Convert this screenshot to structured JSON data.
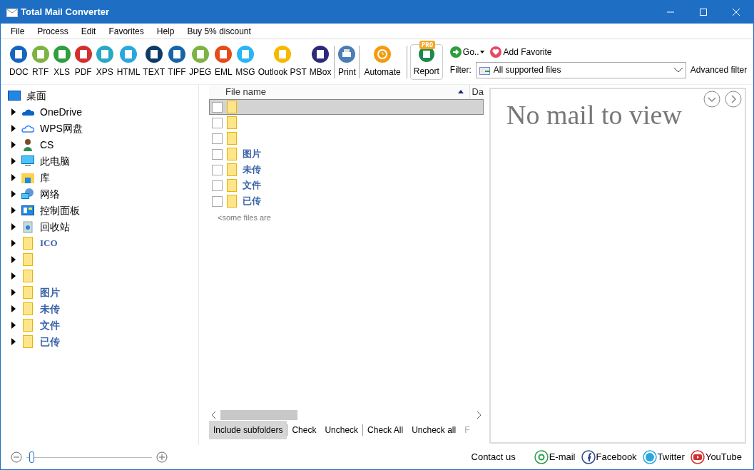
{
  "window": {
    "title": "Total Mail Converter"
  },
  "menu": [
    "File",
    "Process",
    "Edit",
    "Favorites",
    "Help",
    "Buy 5% discount"
  ],
  "toolbar": [
    {
      "label": "DOC",
      "color": "#1565c0"
    },
    {
      "label": "RTF",
      "color": "#7cb342"
    },
    {
      "label": "XLS",
      "color": "#2e9e3e"
    },
    {
      "label": "PDF",
      "color": "#d32f2f"
    },
    {
      "label": "XPS",
      "color": "#26a9c4"
    },
    {
      "label": "HTML",
      "color": "#29a8e0"
    },
    {
      "label": "TEXT",
      "color": "#0d3b66"
    },
    {
      "label": "TIFF",
      "color": "#1565a8"
    },
    {
      "label": "JPEG",
      "color": "#7cb342"
    },
    {
      "label": "EML",
      "color": "#e64a19"
    },
    {
      "label": "MSG",
      "color": "#29b6f6"
    },
    {
      "label": "Outlook PST",
      "color": "#f9b800"
    },
    {
      "label": "MBox",
      "color": "#2e2a7a"
    }
  ],
  "print_button": "Print",
  "automate_button": "Automate",
  "report_button": {
    "label": "Report",
    "badge": "PRO"
  },
  "go_button": "Go..",
  "add_favorite": "Add Favorite",
  "filter": {
    "label": "Filter:",
    "value": "All supported files",
    "advanced": "Advanced filter"
  },
  "tree": [
    {
      "kind": "desktop",
      "label": "桌面",
      "children": [
        {
          "kind": "onedrive",
          "label": "OneDrive"
        },
        {
          "kind": "cloud",
          "label": "WPS网盘"
        },
        {
          "kind": "user",
          "label": "CS"
        },
        {
          "kind": "computer",
          "label": "此电脑"
        },
        {
          "kind": "library",
          "label": "库"
        },
        {
          "kind": "network",
          "label": "网络"
        },
        {
          "kind": "control-panel",
          "label": "控制面板"
        },
        {
          "kind": "recycle",
          "label": "回收站"
        },
        {
          "kind": "folder",
          "label": "ICO"
        },
        {
          "kind": "folder"
        },
        {
          "kind": "folder"
        },
        {
          "kind": "folder",
          "label": "图片"
        },
        {
          "kind": "folder",
          "label": "未传"
        },
        {
          "kind": "folder",
          "label": "文件"
        },
        {
          "kind": "folder",
          "label": "已传"
        }
      ]
    }
  ],
  "file_list": {
    "columns": [
      "File name",
      "Da"
    ],
    "rows": [
      {
        "selected": true,
        "checked": false
      },
      {
        "selected": false,
        "checked": false
      },
      {
        "selected": false,
        "checked": false
      },
      {
        "name": "图片",
        "selected": false,
        "checked": false
      },
      {
        "name": "未传",
        "selected": false,
        "checked": false
      },
      {
        "name": "文件",
        "selected": false,
        "checked": false
      },
      {
        "name": "已传",
        "selected": false,
        "checked": false
      }
    ],
    "note": "<some files are"
  },
  "list_buttons": [
    {
      "label": "Include subfolders",
      "pressed": true
    },
    {
      "label": "Check",
      "pressed": false
    },
    {
      "label": "Uncheck",
      "pressed": false
    },
    {
      "label": "Check All",
      "pressed": false
    },
    {
      "label": "Uncheck all",
      "pressed": false
    },
    {
      "label": "F",
      "pressed": false
    }
  ],
  "preview": {
    "message": "No mail to view"
  },
  "zoom": {
    "level": 0.02
  },
  "footer": {
    "contact": "Contact us",
    "links": [
      {
        "kind": "email",
        "label": "E-mail"
      },
      {
        "kind": "facebook",
        "label": "Facebook"
      },
      {
        "kind": "twitter",
        "label": "Twitter"
      },
      {
        "kind": "youtube",
        "label": "YouTube"
      }
    ]
  }
}
